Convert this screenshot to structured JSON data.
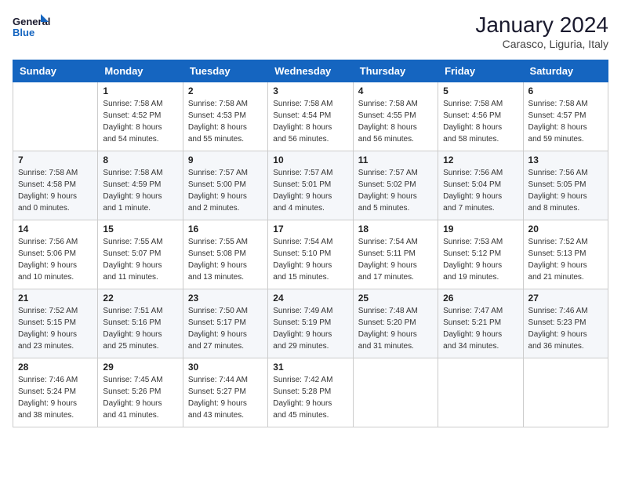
{
  "header": {
    "logo_line1": "General",
    "logo_line2": "Blue",
    "main_title": "January 2024",
    "subtitle": "Carasco, Liguria, Italy"
  },
  "days_of_week": [
    "Sunday",
    "Monday",
    "Tuesday",
    "Wednesday",
    "Thursday",
    "Friday",
    "Saturday"
  ],
  "weeks": [
    [
      {
        "day": "",
        "info": ""
      },
      {
        "day": "1",
        "info": "Sunrise: 7:58 AM\nSunset: 4:52 PM\nDaylight: 8 hours\nand 54 minutes."
      },
      {
        "day": "2",
        "info": "Sunrise: 7:58 AM\nSunset: 4:53 PM\nDaylight: 8 hours\nand 55 minutes."
      },
      {
        "day": "3",
        "info": "Sunrise: 7:58 AM\nSunset: 4:54 PM\nDaylight: 8 hours\nand 56 minutes."
      },
      {
        "day": "4",
        "info": "Sunrise: 7:58 AM\nSunset: 4:55 PM\nDaylight: 8 hours\nand 56 minutes."
      },
      {
        "day": "5",
        "info": "Sunrise: 7:58 AM\nSunset: 4:56 PM\nDaylight: 8 hours\nand 58 minutes."
      },
      {
        "day": "6",
        "info": "Sunrise: 7:58 AM\nSunset: 4:57 PM\nDaylight: 8 hours\nand 59 minutes."
      }
    ],
    [
      {
        "day": "7",
        "info": "Sunrise: 7:58 AM\nSunset: 4:58 PM\nDaylight: 9 hours\nand 0 minutes."
      },
      {
        "day": "8",
        "info": "Sunrise: 7:58 AM\nSunset: 4:59 PM\nDaylight: 9 hours\nand 1 minute."
      },
      {
        "day": "9",
        "info": "Sunrise: 7:57 AM\nSunset: 5:00 PM\nDaylight: 9 hours\nand 2 minutes."
      },
      {
        "day": "10",
        "info": "Sunrise: 7:57 AM\nSunset: 5:01 PM\nDaylight: 9 hours\nand 4 minutes."
      },
      {
        "day": "11",
        "info": "Sunrise: 7:57 AM\nSunset: 5:02 PM\nDaylight: 9 hours\nand 5 minutes."
      },
      {
        "day": "12",
        "info": "Sunrise: 7:56 AM\nSunset: 5:04 PM\nDaylight: 9 hours\nand 7 minutes."
      },
      {
        "day": "13",
        "info": "Sunrise: 7:56 AM\nSunset: 5:05 PM\nDaylight: 9 hours\nand 8 minutes."
      }
    ],
    [
      {
        "day": "14",
        "info": "Sunrise: 7:56 AM\nSunset: 5:06 PM\nDaylight: 9 hours\nand 10 minutes."
      },
      {
        "day": "15",
        "info": "Sunrise: 7:55 AM\nSunset: 5:07 PM\nDaylight: 9 hours\nand 11 minutes."
      },
      {
        "day": "16",
        "info": "Sunrise: 7:55 AM\nSunset: 5:08 PM\nDaylight: 9 hours\nand 13 minutes."
      },
      {
        "day": "17",
        "info": "Sunrise: 7:54 AM\nSunset: 5:10 PM\nDaylight: 9 hours\nand 15 minutes."
      },
      {
        "day": "18",
        "info": "Sunrise: 7:54 AM\nSunset: 5:11 PM\nDaylight: 9 hours\nand 17 minutes."
      },
      {
        "day": "19",
        "info": "Sunrise: 7:53 AM\nSunset: 5:12 PM\nDaylight: 9 hours\nand 19 minutes."
      },
      {
        "day": "20",
        "info": "Sunrise: 7:52 AM\nSunset: 5:13 PM\nDaylight: 9 hours\nand 21 minutes."
      }
    ],
    [
      {
        "day": "21",
        "info": "Sunrise: 7:52 AM\nSunset: 5:15 PM\nDaylight: 9 hours\nand 23 minutes."
      },
      {
        "day": "22",
        "info": "Sunrise: 7:51 AM\nSunset: 5:16 PM\nDaylight: 9 hours\nand 25 minutes."
      },
      {
        "day": "23",
        "info": "Sunrise: 7:50 AM\nSunset: 5:17 PM\nDaylight: 9 hours\nand 27 minutes."
      },
      {
        "day": "24",
        "info": "Sunrise: 7:49 AM\nSunset: 5:19 PM\nDaylight: 9 hours\nand 29 minutes."
      },
      {
        "day": "25",
        "info": "Sunrise: 7:48 AM\nSunset: 5:20 PM\nDaylight: 9 hours\nand 31 minutes."
      },
      {
        "day": "26",
        "info": "Sunrise: 7:47 AM\nSunset: 5:21 PM\nDaylight: 9 hours\nand 34 minutes."
      },
      {
        "day": "27",
        "info": "Sunrise: 7:46 AM\nSunset: 5:23 PM\nDaylight: 9 hours\nand 36 minutes."
      }
    ],
    [
      {
        "day": "28",
        "info": "Sunrise: 7:46 AM\nSunset: 5:24 PM\nDaylight: 9 hours\nand 38 minutes."
      },
      {
        "day": "29",
        "info": "Sunrise: 7:45 AM\nSunset: 5:26 PM\nDaylight: 9 hours\nand 41 minutes."
      },
      {
        "day": "30",
        "info": "Sunrise: 7:44 AM\nSunset: 5:27 PM\nDaylight: 9 hours\nand 43 minutes."
      },
      {
        "day": "31",
        "info": "Sunrise: 7:42 AM\nSunset: 5:28 PM\nDaylight: 9 hours\nand 45 minutes."
      },
      {
        "day": "",
        "info": ""
      },
      {
        "day": "",
        "info": ""
      },
      {
        "day": "",
        "info": ""
      }
    ]
  ]
}
